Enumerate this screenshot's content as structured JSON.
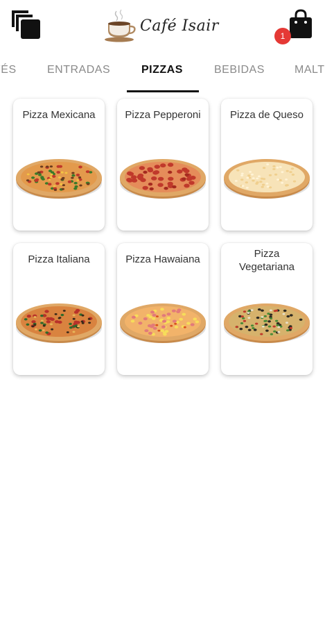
{
  "header": {
    "app_name": "Café Isair",
    "menu_icon": "layers-icon",
    "cart_icon": "shopping-bag-icon",
    "cart_count": "1",
    "badge_color": "#e53935"
  },
  "tabs": [
    {
      "label": "FÉS",
      "active": false
    },
    {
      "label": "ENTRADAS",
      "active": false
    },
    {
      "label": "PIZZAS",
      "active": true
    },
    {
      "label": "BEBIDAS",
      "active": false
    },
    {
      "label": "MALT",
      "active": false
    }
  ],
  "products": [
    {
      "name": "Pizza Mexicana",
      "topping": "mexicana"
    },
    {
      "name": "Pizza Pepperoni",
      "topping": "pepperoni"
    },
    {
      "name": "Pizza de Queso",
      "topping": "queso"
    },
    {
      "name": "Pizza Italiana",
      "topping": "italiana"
    },
    {
      "name": "Pizza Hawaiana",
      "topping": "hawaiana"
    },
    {
      "name": "Pizza Vegetariana",
      "topping": "vegetariana"
    }
  ]
}
